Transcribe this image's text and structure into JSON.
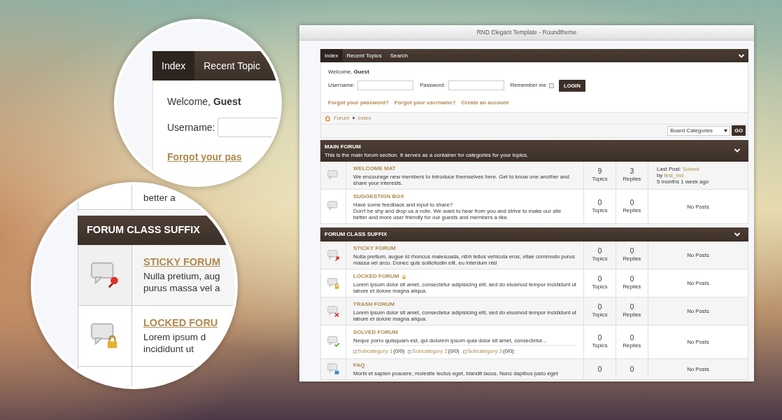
{
  "window": {
    "title": "RND Elegant Template - Roundtheme"
  },
  "nav": {
    "tabs": [
      {
        "label": "Index",
        "selected": true
      },
      {
        "label": "Recent Topics",
        "selected": false
      },
      {
        "label": "Search",
        "selected": false
      }
    ]
  },
  "login": {
    "welcome": "Welcome, **Guest**",
    "username_label": "Username:",
    "password_label": "Password:",
    "remember_label": "Remember me",
    "remember_checked": false,
    "button": "LOGIN",
    "links": [
      "Forgot your password?",
      "Forgot your username?",
      "Create an account"
    ]
  },
  "breadcrumb": [
    "Forum",
    "Index"
  ],
  "jump": {
    "value": "Board Categories",
    "button": "GO"
  },
  "sections": [
    {
      "title": "MAIN FORUM",
      "description": "This is the main forum section. It serves as a container for categories for your topics.",
      "forums": [
        {
          "kind": "plain",
          "title": "WELCOME MAT",
          "description": "We encourage new members to introduce themselves here. Get to know one another and share your interests.",
          "topics": "9",
          "topics_label": "Topics",
          "replies": "3",
          "replies_label": "Replies",
          "last_post": {
            "label": "Last Post:",
            "title": "Solved",
            "by": "by",
            "author": "test_md",
            "time": "5 months 1 week ago"
          }
        },
        {
          "kind": "plain",
          "title": "SUGGESTION BOX",
          "description": "Have some feedback and input to share?\nDon't be shy and drop us a note. We want to hear from you and strive to make our site better and more user friendly for our guests and members a like.",
          "topics": "0",
          "topics_label": "Topics",
          "replies": "0",
          "replies_label": "Replies",
          "no_posts": "No Posts"
        }
      ]
    },
    {
      "title": "FORUM CLASS SUFFIX",
      "forums": [
        {
          "kind": "sticky",
          "title": "STICKY FORUM",
          "description": "Nulla pretium, augue id rhoncus malesuada, nibh tellus vehicula eros, vitae commodo purus massa vel arcu. Donec quis sollicitudin elit, eu interdum nisl",
          "topics": "0",
          "topics_label": "Topics",
          "replies": "0",
          "replies_label": "Replies",
          "no_posts": "No Posts"
        },
        {
          "kind": "locked",
          "title": "LOCKED FORUM",
          "description": "Lorem ipsum dolor sit amet, consectetur adipisicing elit, sed do eiusmod tempor incididunt ut labore et dolore magna aliqua.",
          "topics": "0",
          "topics_label": "Topics",
          "replies": "0",
          "replies_label": "Replies",
          "no_posts": "No Posts"
        },
        {
          "kind": "trash",
          "title": "TRASH FORUM",
          "description": "Lorem ipsum dolor sit amet, consectetur adipisicing elit, sed do eiusmod tempor incididunt ut labore et dolore magna aliqua.",
          "topics": "0",
          "topics_label": "Topics",
          "replies": "0",
          "replies_label": "Replies",
          "no_posts": "No Posts"
        },
        {
          "kind": "solved",
          "title": "SOLVED FORUM",
          "description": "Neque porro quisquam est, qui dolorem ipsum quia dolor sit amet, consectetur...",
          "subcategories": [
            {
              "name": "Subcategory 1",
              "count": "(0/0)"
            },
            {
              "name": "Subcategory 2",
              "count": "(0/0)"
            },
            {
              "name": "Subcategory 3",
              "count": "(0/0)"
            }
          ],
          "topics": "0",
          "topics_label": "Topics",
          "replies": "0",
          "replies_label": "Replies",
          "no_posts": "No Posts"
        },
        {
          "kind": "faq",
          "title": "FAQ",
          "description": "Morbi et sapien posuere, molestie lectus eget, blandit lacus. Nunc dapibus justo eget",
          "topics": "0",
          "replies": "0",
          "no_posts": "No Posts"
        }
      ]
    }
  ],
  "zoom_top": {
    "tabs": [
      {
        "label": "Index",
        "selected": true
      },
      {
        "label": "Recent Topic",
        "selected": false
      }
    ],
    "welcome": "Welcome, **Guest**",
    "username_label": "Username:",
    "link": "Forgot your pas"
  },
  "zoom_bottom": {
    "prev_text": "better a",
    "section_title": "FORUM CLASS SUFFIX",
    "forums": [
      {
        "kind": "sticky",
        "title": "STICKY FORUM",
        "lines": [
          "Nulla pretium, aug",
          "purus massa vel a"
        ]
      },
      {
        "kind": "locked",
        "title": "LOCKED FORU",
        "lines": [
          "Lorem ipsum d",
          "incididunt ut"
        ]
      }
    ]
  }
}
